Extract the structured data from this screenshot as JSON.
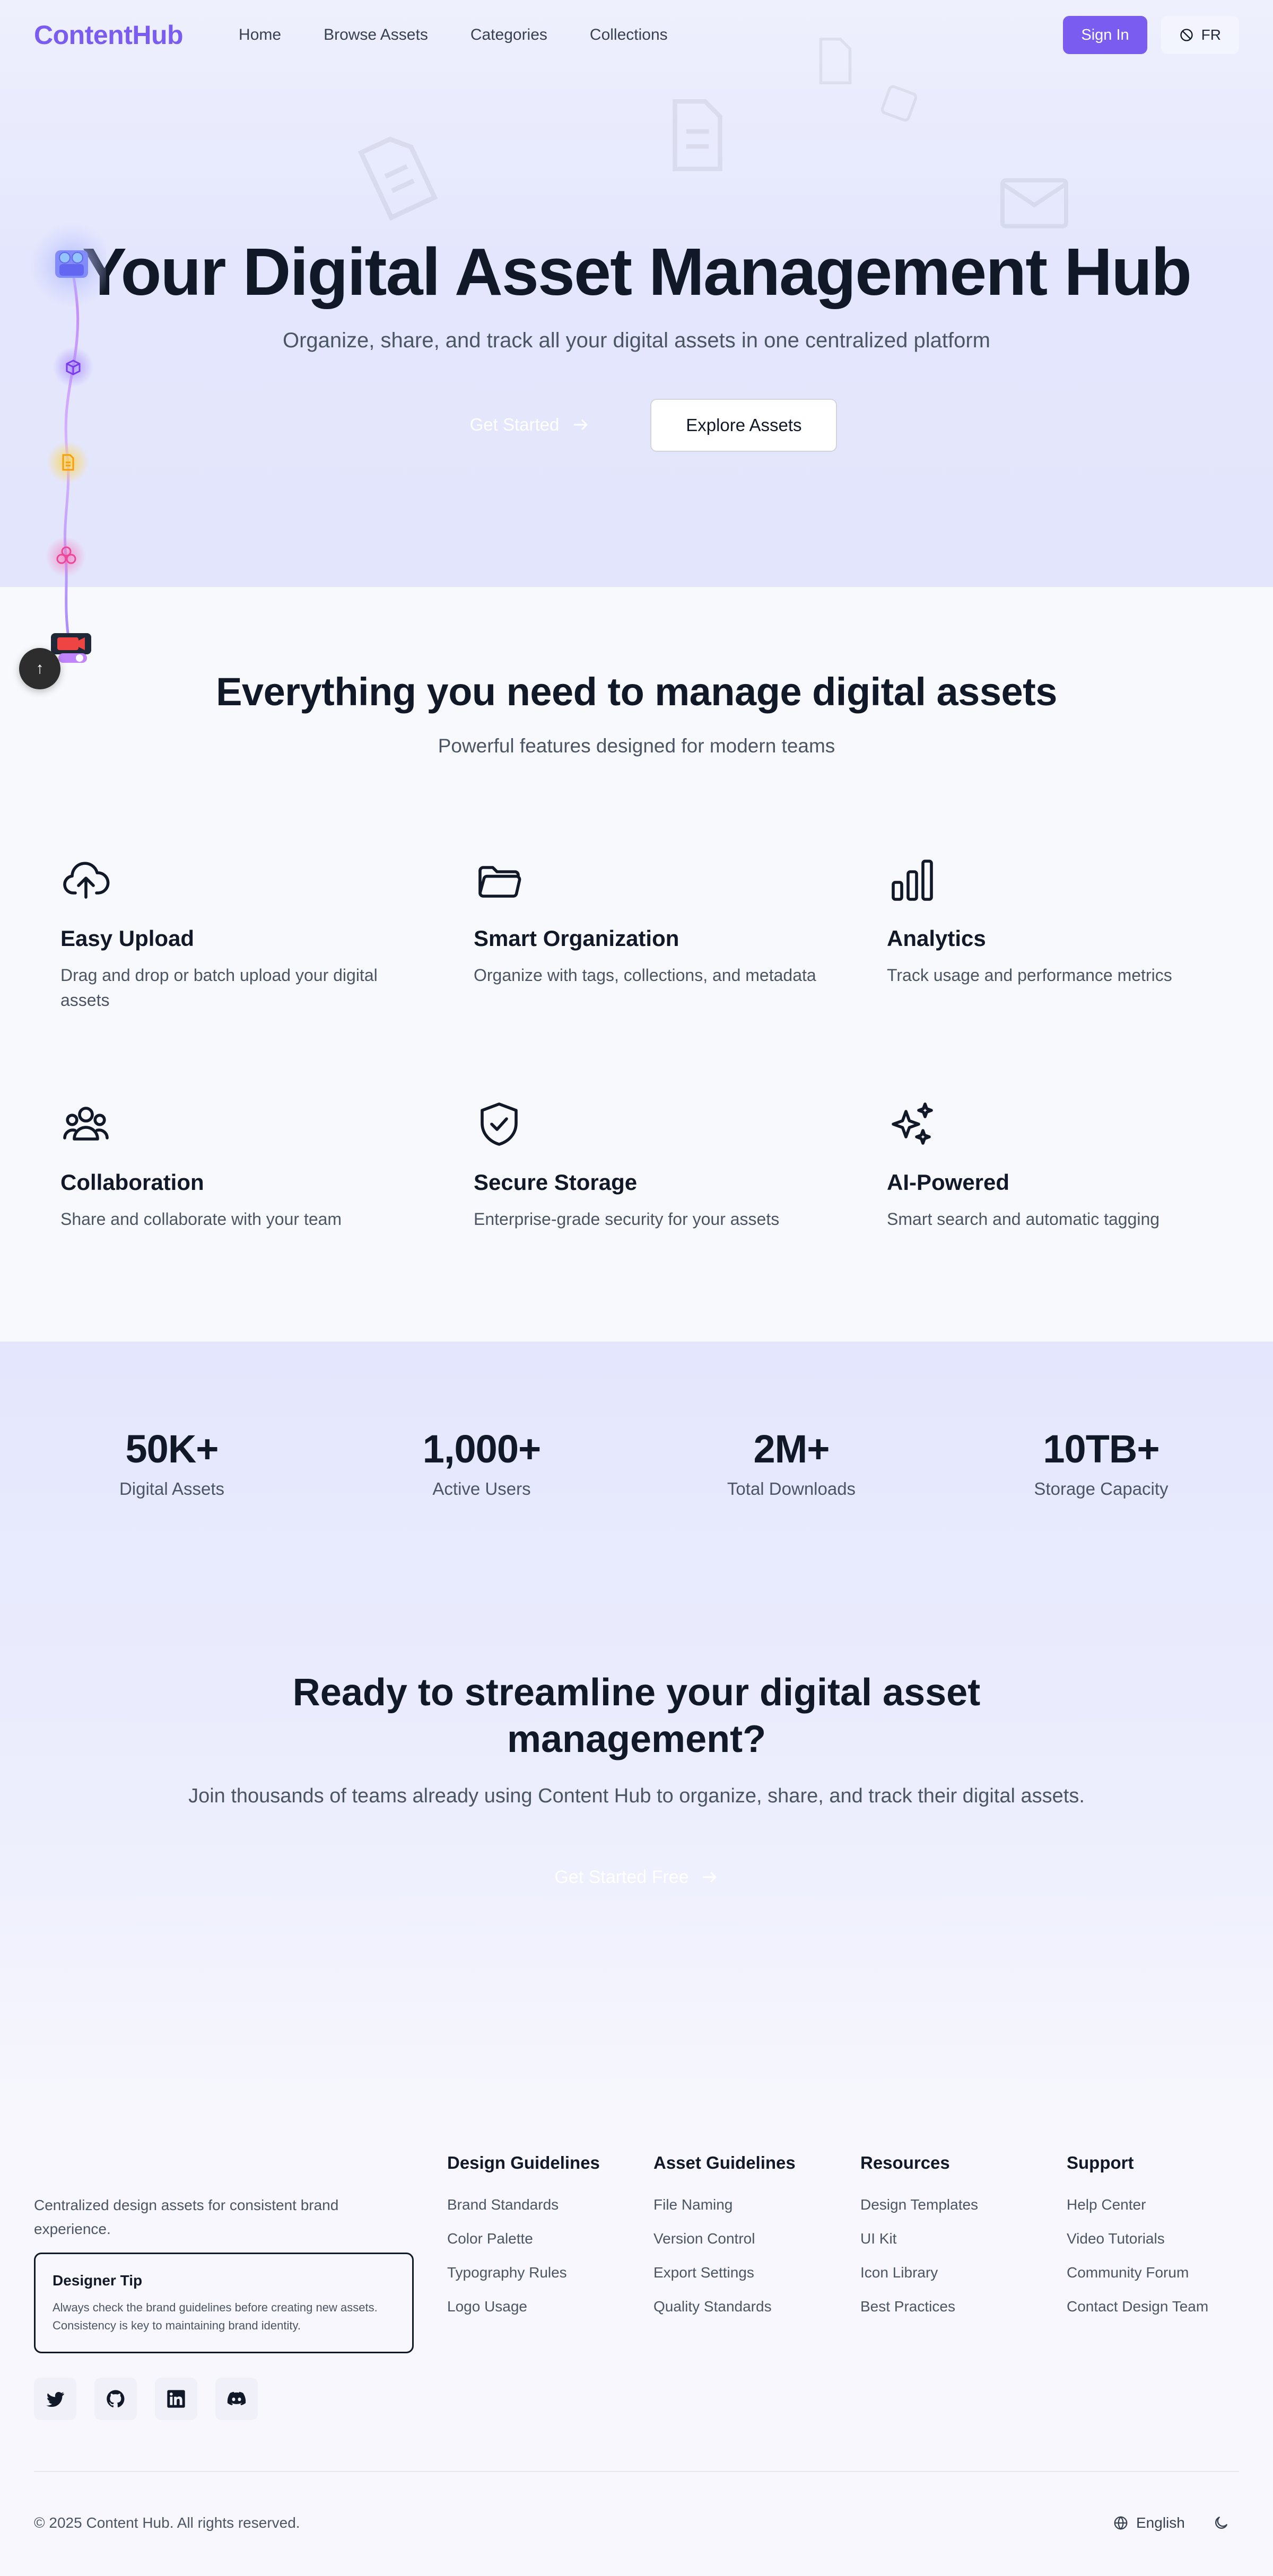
{
  "brand": {
    "name": "ContentHub",
    "accent": "#7a5cf0"
  },
  "nav": {
    "links": [
      "Home",
      "Browse Assets",
      "Categories",
      "Collections"
    ],
    "signin_label": "Sign In",
    "lang_label": "FR",
    "lang_icon": "globe-slash-icon"
  },
  "hero": {
    "title": "Your Digital Asset Management Hub",
    "subtitle": "Organize, share, and track all your digital assets in one centralized platform",
    "primary_button": "Get Started",
    "secondary_button": "Explore Assets"
  },
  "timeline": {
    "nodes": [
      {
        "icon": "image-stack-icon",
        "color": "#7b8cf5"
      },
      {
        "icon": "cube-icon",
        "color": "#8b5cf6"
      },
      {
        "icon": "document-icon",
        "color": "#f59e0b"
      },
      {
        "icon": "share-icon",
        "color": "#ec4899"
      },
      {
        "icon": "video-icon",
        "color": "#ef4444"
      }
    ]
  },
  "features": {
    "title": "Everything you need to manage digital assets",
    "subtitle": "Powerful features designed for modern teams",
    "items": [
      {
        "icon": "cloud-upload-icon",
        "title": "Easy Upload",
        "desc": "Drag and drop or batch upload your digital assets"
      },
      {
        "icon": "folder-open-icon",
        "title": "Smart Organization",
        "desc": "Organize with tags, collections, and metadata"
      },
      {
        "icon": "bar-chart-icon",
        "title": "Analytics",
        "desc": "Track usage and performance metrics"
      },
      {
        "icon": "users-icon",
        "title": "Collaboration",
        "desc": "Share and collaborate with your team"
      },
      {
        "icon": "shield-check-icon",
        "title": "Secure Storage",
        "desc": "Enterprise-grade security for your assets"
      },
      {
        "icon": "sparkles-icon",
        "title": "AI-Powered",
        "desc": "Smart search and automatic tagging"
      }
    ]
  },
  "stats": [
    {
      "value": "50K+",
      "label": "Digital Assets"
    },
    {
      "value": "1,000+",
      "label": "Active Users"
    },
    {
      "value": "2M+",
      "label": "Total Downloads"
    },
    {
      "value": "10TB+",
      "label": "Storage Capacity"
    }
  ],
  "cta": {
    "title": "Ready to streamline your digital asset management?",
    "subtitle": "Join thousands of teams already using Content Hub to organize, share, and track their digital assets.",
    "button": "Get Started Free"
  },
  "footer": {
    "description": "Centralized design assets for consistent brand experience.",
    "tip": {
      "title": "Designer Tip",
      "body": "Always check the brand guidelines before creating new assets. Consistency is key to maintaining brand identity."
    },
    "socials": [
      "twitter-icon",
      "github-icon",
      "linkedin-icon",
      "discord-icon"
    ],
    "columns": [
      {
        "title": "Design Guidelines",
        "links": [
          "Brand Standards",
          "Color Palette",
          "Typography Rules",
          "Logo Usage"
        ]
      },
      {
        "title": "Asset Guidelines",
        "links": [
          "File Naming",
          "Version Control",
          "Export Settings",
          "Quality Standards"
        ]
      },
      {
        "title": "Resources",
        "links": [
          "Design Templates",
          "UI Kit",
          "Icon Library",
          "Best Practices"
        ]
      },
      {
        "title": "Support",
        "links": [
          "Help Center",
          "Video Tutorials",
          "Community Forum",
          "Contact Design Team"
        ]
      }
    ],
    "copyright": "© 2025 Content Hub. All rights reserved.",
    "language": "English"
  }
}
